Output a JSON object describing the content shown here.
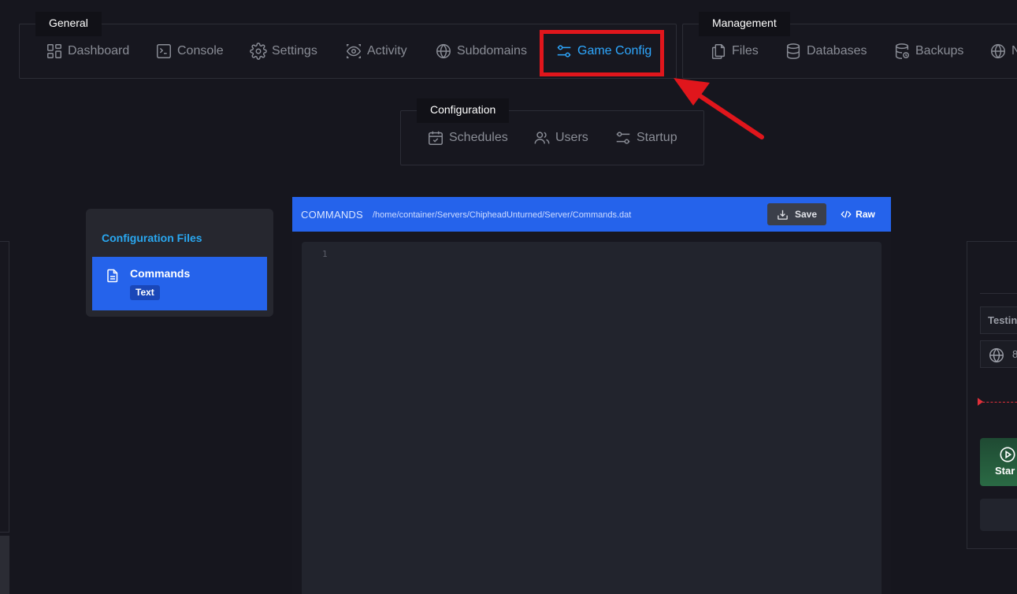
{
  "nav": {
    "general": {
      "title": "General",
      "items": [
        {
          "label": "Dashboard",
          "icon": "grid-icon"
        },
        {
          "label": "Console",
          "icon": "terminal-icon"
        },
        {
          "label": "Settings",
          "icon": "gear-icon"
        },
        {
          "label": "Activity",
          "icon": "eye-icon"
        },
        {
          "label": "Subdomains",
          "icon": "globe-icon"
        },
        {
          "label": "Game Config",
          "icon": "sliders-icon",
          "active": true
        }
      ]
    },
    "management": {
      "title": "Management",
      "items": [
        {
          "label": "Files",
          "icon": "files-icon"
        },
        {
          "label": "Databases",
          "icon": "database-icon"
        },
        {
          "label": "Backups",
          "icon": "backup-icon"
        },
        {
          "label": "N",
          "icon": "globe-icon"
        }
      ]
    },
    "configuration": {
      "title": "Configuration",
      "items": [
        {
          "label": "Schedules",
          "icon": "calendar-icon"
        },
        {
          "label": "Users",
          "icon": "users-icon"
        },
        {
          "label": "Startup",
          "icon": "sliders-icon"
        }
      ]
    }
  },
  "config_files": {
    "title": "Configuration Files",
    "items": [
      {
        "name": "Commands",
        "badge": "Text"
      }
    ]
  },
  "editor": {
    "name": "COMMANDS",
    "path": "/home/container/Servers/ChipheadUnturned/Server/Commands.dat",
    "save_label": "Save",
    "raw_label": "Raw",
    "line_numbers": [
      "1"
    ]
  },
  "right_panel": {
    "server_name": "Testin",
    "address": "8",
    "start_label": "Star"
  },
  "colors": {
    "background": "#16161e",
    "accent": "#2563eb",
    "active_nav": "#2ea8ff",
    "highlight": "#e0161c"
  }
}
